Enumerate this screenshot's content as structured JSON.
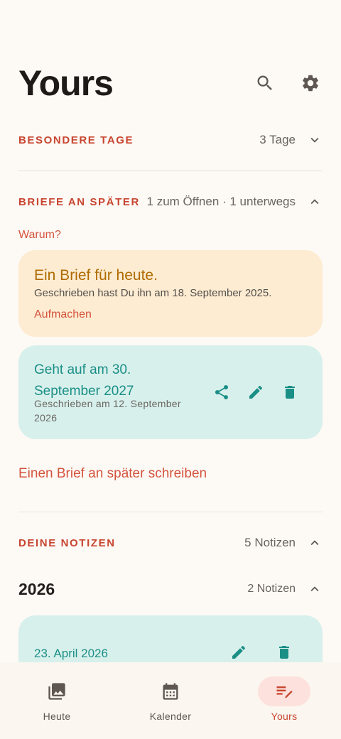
{
  "header": {
    "title": "Yours",
    "icons": [
      "search-icon",
      "gear-icon"
    ]
  },
  "special_days": {
    "title": "BESONDERE TAGE",
    "meta": "3 Tage",
    "expanded": false
  },
  "letters": {
    "title": "BRIEFE AN SPÄTER",
    "meta": "1 zum Öffnen · 1 unterwegs",
    "expanded": true,
    "why_link": "Warum?",
    "today_card": {
      "title": "Ein Brief für heute.",
      "subtitle": "Geschrieben hast Du ihn am 18. September 2025.",
      "action": "Aufmachen"
    },
    "future_card": {
      "title": "Geht auf am 30. September 2027",
      "subtitle": "Geschrieben am 12. September 2026",
      "actions": [
        "share-icon",
        "edit-icon",
        "delete-icon"
      ]
    },
    "write_link": "Einen Brief an später schreiben"
  },
  "notes": {
    "title": "DEINE NOTIZEN",
    "meta": "5 Notizen",
    "expanded": true,
    "year_group": {
      "year": "2026",
      "meta": "2 Notizen",
      "expanded": true
    },
    "first_note": {
      "date": "23. April 2026",
      "actions": [
        "edit-icon",
        "delete-icon"
      ]
    }
  },
  "bottom_nav": {
    "items": [
      {
        "label": "Heute",
        "icon": "photo-icon",
        "active": false
      },
      {
        "label": "Kalender",
        "icon": "calendar-icon",
        "active": false
      },
      {
        "label": "Yours",
        "icon": "notes-edit-icon",
        "active": true
      }
    ]
  },
  "colors": {
    "accent": "#c8452f",
    "background": "#fdfaf6",
    "letter_card": "#fdecd2",
    "letter_title": "#b06b00",
    "teal_card": "#d8f0ec",
    "teal_text": "#1a8f86"
  }
}
